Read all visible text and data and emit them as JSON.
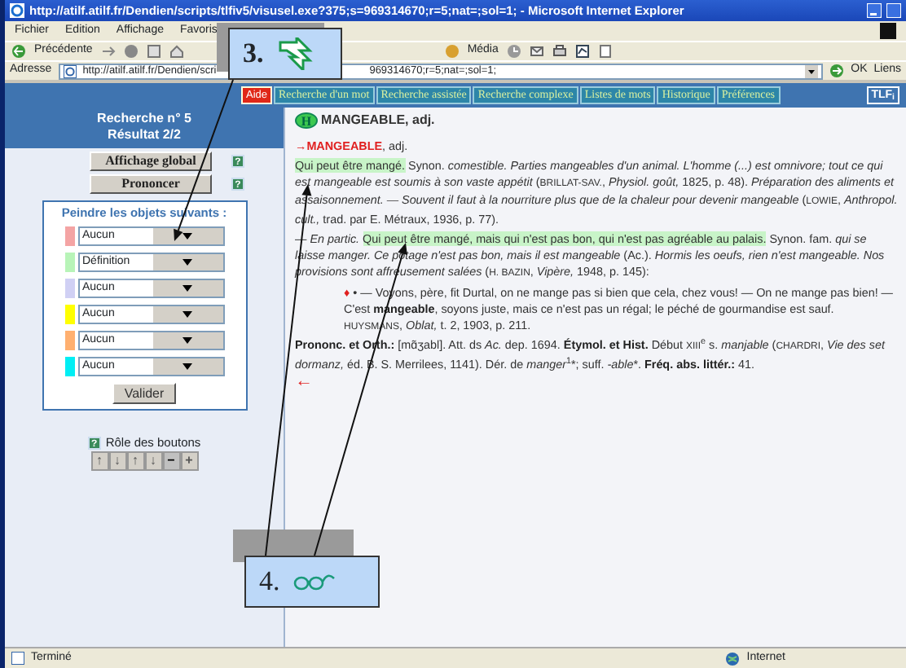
{
  "window": {
    "title": "http://atilf.atilf.fr/Dendien/scripts/tlfiv5/visusel.exe?375;s=969314670;r=5;nat=;sol=1; - Microsoft Internet Explorer"
  },
  "menu": [
    "Fichier",
    "Edition",
    "Affichage",
    "Favoris"
  ],
  "toolbar": {
    "back": "Précédente",
    "media": "Média"
  },
  "address": {
    "label": "Adresse",
    "value_start": "http://atilf.atilf.fr/Dendien/scri",
    "value_end": "969314670;r=5;nat=;sol=1;",
    "go": "OK",
    "links": "Liens"
  },
  "nav": {
    "help": "Aide",
    "tabs": [
      "Recherche d'un mot",
      "Recherche assistée",
      "Recherche complexe",
      "Listes de mots",
      "Historique",
      "Préférences"
    ],
    "logo": "TLF$_{i}$"
  },
  "sidebar": {
    "search_no": "Recherche n° 5",
    "result": "Résultat 2/2",
    "buttons": [
      {
        "label": "Affichage global",
        "help": "?"
      },
      {
        "label": "Prononcer",
        "help": "?"
      }
    ],
    "paint": {
      "title": "Peindre les objets suivants :",
      "submit": "Valider",
      "rows": [
        {
          "color": "#f4a4a4",
          "value": "Aucun"
        },
        {
          "color": "#b8f4b8",
          "value": "Définition"
        },
        {
          "color": "#d0d0f4",
          "value": "Aucun"
        },
        {
          "color": "#ffff00",
          "value": "Aucun"
        },
        {
          "color": "#ffb070",
          "value": "Aucun"
        },
        {
          "color": "#00eef4",
          "value": "Aucun"
        }
      ]
    },
    "roles": {
      "help": "?",
      "label": "Rôle des boutons",
      "buttons": [
        {
          "label": "↑",
          "disabled": true
        },
        {
          "label": "↓",
          "disabled": true
        },
        {
          "label": "↑",
          "disabled": true
        },
        {
          "label": "↓",
          "disabled": true
        },
        {
          "label": "−",
          "disabled": false
        },
        {
          "label": "+",
          "disabled": true
        }
      ]
    }
  },
  "entry": {
    "badge": "H",
    "headword": "MANGEABLE, adj.",
    "paragraphs": [
      {
        "kind": "plain",
        "runs": [
          {
            "kind": "red",
            "text": "→MANGEABLE"
          },
          {
            "kind": "r",
            "text": ", adj."
          }
        ]
      },
      {
        "kind": "plain",
        "runs": [
          {
            "kind": "hl",
            "text": "Qui peut être mangé."
          },
          {
            "kind": "r",
            "text": " Synon. "
          },
          {
            "kind": "i",
            "text": "comestible. Parties mangeables d'un animal. L'homme (...) est omnivore; tout ce qui est mangeable est soumis à son vaste appétit"
          },
          {
            "kind": "r",
            "text": " ("
          },
          {
            "kind": "sc",
            "text": "BRILLAT-SAV."
          },
          {
            "kind": "r",
            "text": ", "
          },
          {
            "kind": "i",
            "text": "Physiol. goût,"
          },
          {
            "kind": "r",
            "text": " 1825, p. 48). "
          },
          {
            "kind": "i",
            "text": "Préparation des aliments et assaisonnement. — Souvent il faut à la nourriture plus que de la chaleur pour devenir mangeable"
          },
          {
            "kind": "r",
            "text": " ("
          },
          {
            "kind": "sc",
            "text": "LOWIE"
          },
          {
            "kind": "r",
            "text": ", "
          },
          {
            "kind": "i",
            "text": "Anthropol. cult.,"
          },
          {
            "kind": "r",
            "text": " trad. par E. Métraux, 1936, p. 77)."
          }
        ]
      },
      {
        "kind": "plain",
        "runs": [
          {
            "kind": "r",
            "text": "— "
          },
          {
            "kind": "i",
            "text": "En partic. "
          },
          {
            "kind": "hl",
            "text": "Qui peut être mangé, mais qui n'est pas bon, qui n'est pas agréable au palais."
          },
          {
            "kind": "r",
            "text": " Synon. fam. "
          },
          {
            "kind": "i",
            "text": "qui se laisse manger. Ce potage n'est pas bon, mais il est mangeable"
          },
          {
            "kind": "r",
            "text": " (Ac.). "
          },
          {
            "kind": "i",
            "text": "Hormis les oeufs, rien n'est mangeable. Nos provisions sont affreusement salées"
          },
          {
            "kind": "r",
            "text": " ("
          },
          {
            "kind": "sc",
            "text": "H. BAZIN"
          },
          {
            "kind": "r",
            "text": ", "
          },
          {
            "kind": "i",
            "text": "Vipère,"
          },
          {
            "kind": "r",
            "text": " 1948, p. 145):"
          }
        ]
      },
      {
        "kind": "quote",
        "runs": [
          {
            "kind": "red",
            "text": "♦"
          },
          {
            "kind": "r",
            "text": " • — Voyons, père, fit Durtal, on ne mange pas si bien que cela, chez vous! — On ne mange pas bien! — C'est "
          },
          {
            "kind": "b",
            "text": "mangeable"
          },
          {
            "kind": "r",
            "text": ", soyons juste, mais ce n'est pas un régal; le péché de gourmandise est sauf."
          }
        ]
      },
      {
        "kind": "quote",
        "runs": [
          {
            "kind": "sc",
            "text": "HUYSMANS"
          },
          {
            "kind": "r",
            "text": ", "
          },
          {
            "kind": "i",
            "text": "Oblat,"
          },
          {
            "kind": "r",
            "text": " t. 2, 1903, p. 211."
          }
        ]
      },
      {
        "kind": "plain",
        "runs": [
          {
            "kind": "b",
            "text": "Prononc. et Orth.:"
          },
          {
            "kind": "r",
            "text": " [mɑ̃ʒabl]. Att. ds "
          },
          {
            "kind": "i",
            "text": "Ac."
          },
          {
            "kind": "r",
            "text": " dep. 1694. "
          },
          {
            "kind": "b",
            "text": "Étymol. et Hist."
          },
          {
            "kind": "r",
            "text": " Début "
          },
          {
            "kind": "sc",
            "text": "XIII"
          },
          {
            "kind": "sup",
            "text": "e"
          },
          {
            "kind": "r",
            "text": " s. "
          },
          {
            "kind": "i",
            "text": "manjable"
          },
          {
            "kind": "r",
            "text": " ("
          },
          {
            "kind": "sc",
            "text": "CHARDRI"
          },
          {
            "kind": "r",
            "text": ", "
          },
          {
            "kind": "i",
            "text": "Vie des set dormanz,"
          },
          {
            "kind": "r",
            "text": " éd. B. S. Merrilees, 1141). Dér. de "
          },
          {
            "kind": "i",
            "text": "manger"
          },
          {
            "kind": "sup",
            "text": "1"
          },
          {
            "kind": "r",
            "text": "*; suff. "
          },
          {
            "kind": "i",
            "text": "-able"
          },
          {
            "kind": "r",
            "text": "*. "
          },
          {
            "kind": "b",
            "text": "Fréq. abs. littér.:"
          },
          {
            "kind": "r",
            "text": " 41."
          }
        ]
      }
    ],
    "back": "←"
  },
  "callouts": [
    {
      "number": "3."
    },
    {
      "number": "4."
    }
  ],
  "status": {
    "text": "Terminé",
    "zone": "Internet"
  }
}
